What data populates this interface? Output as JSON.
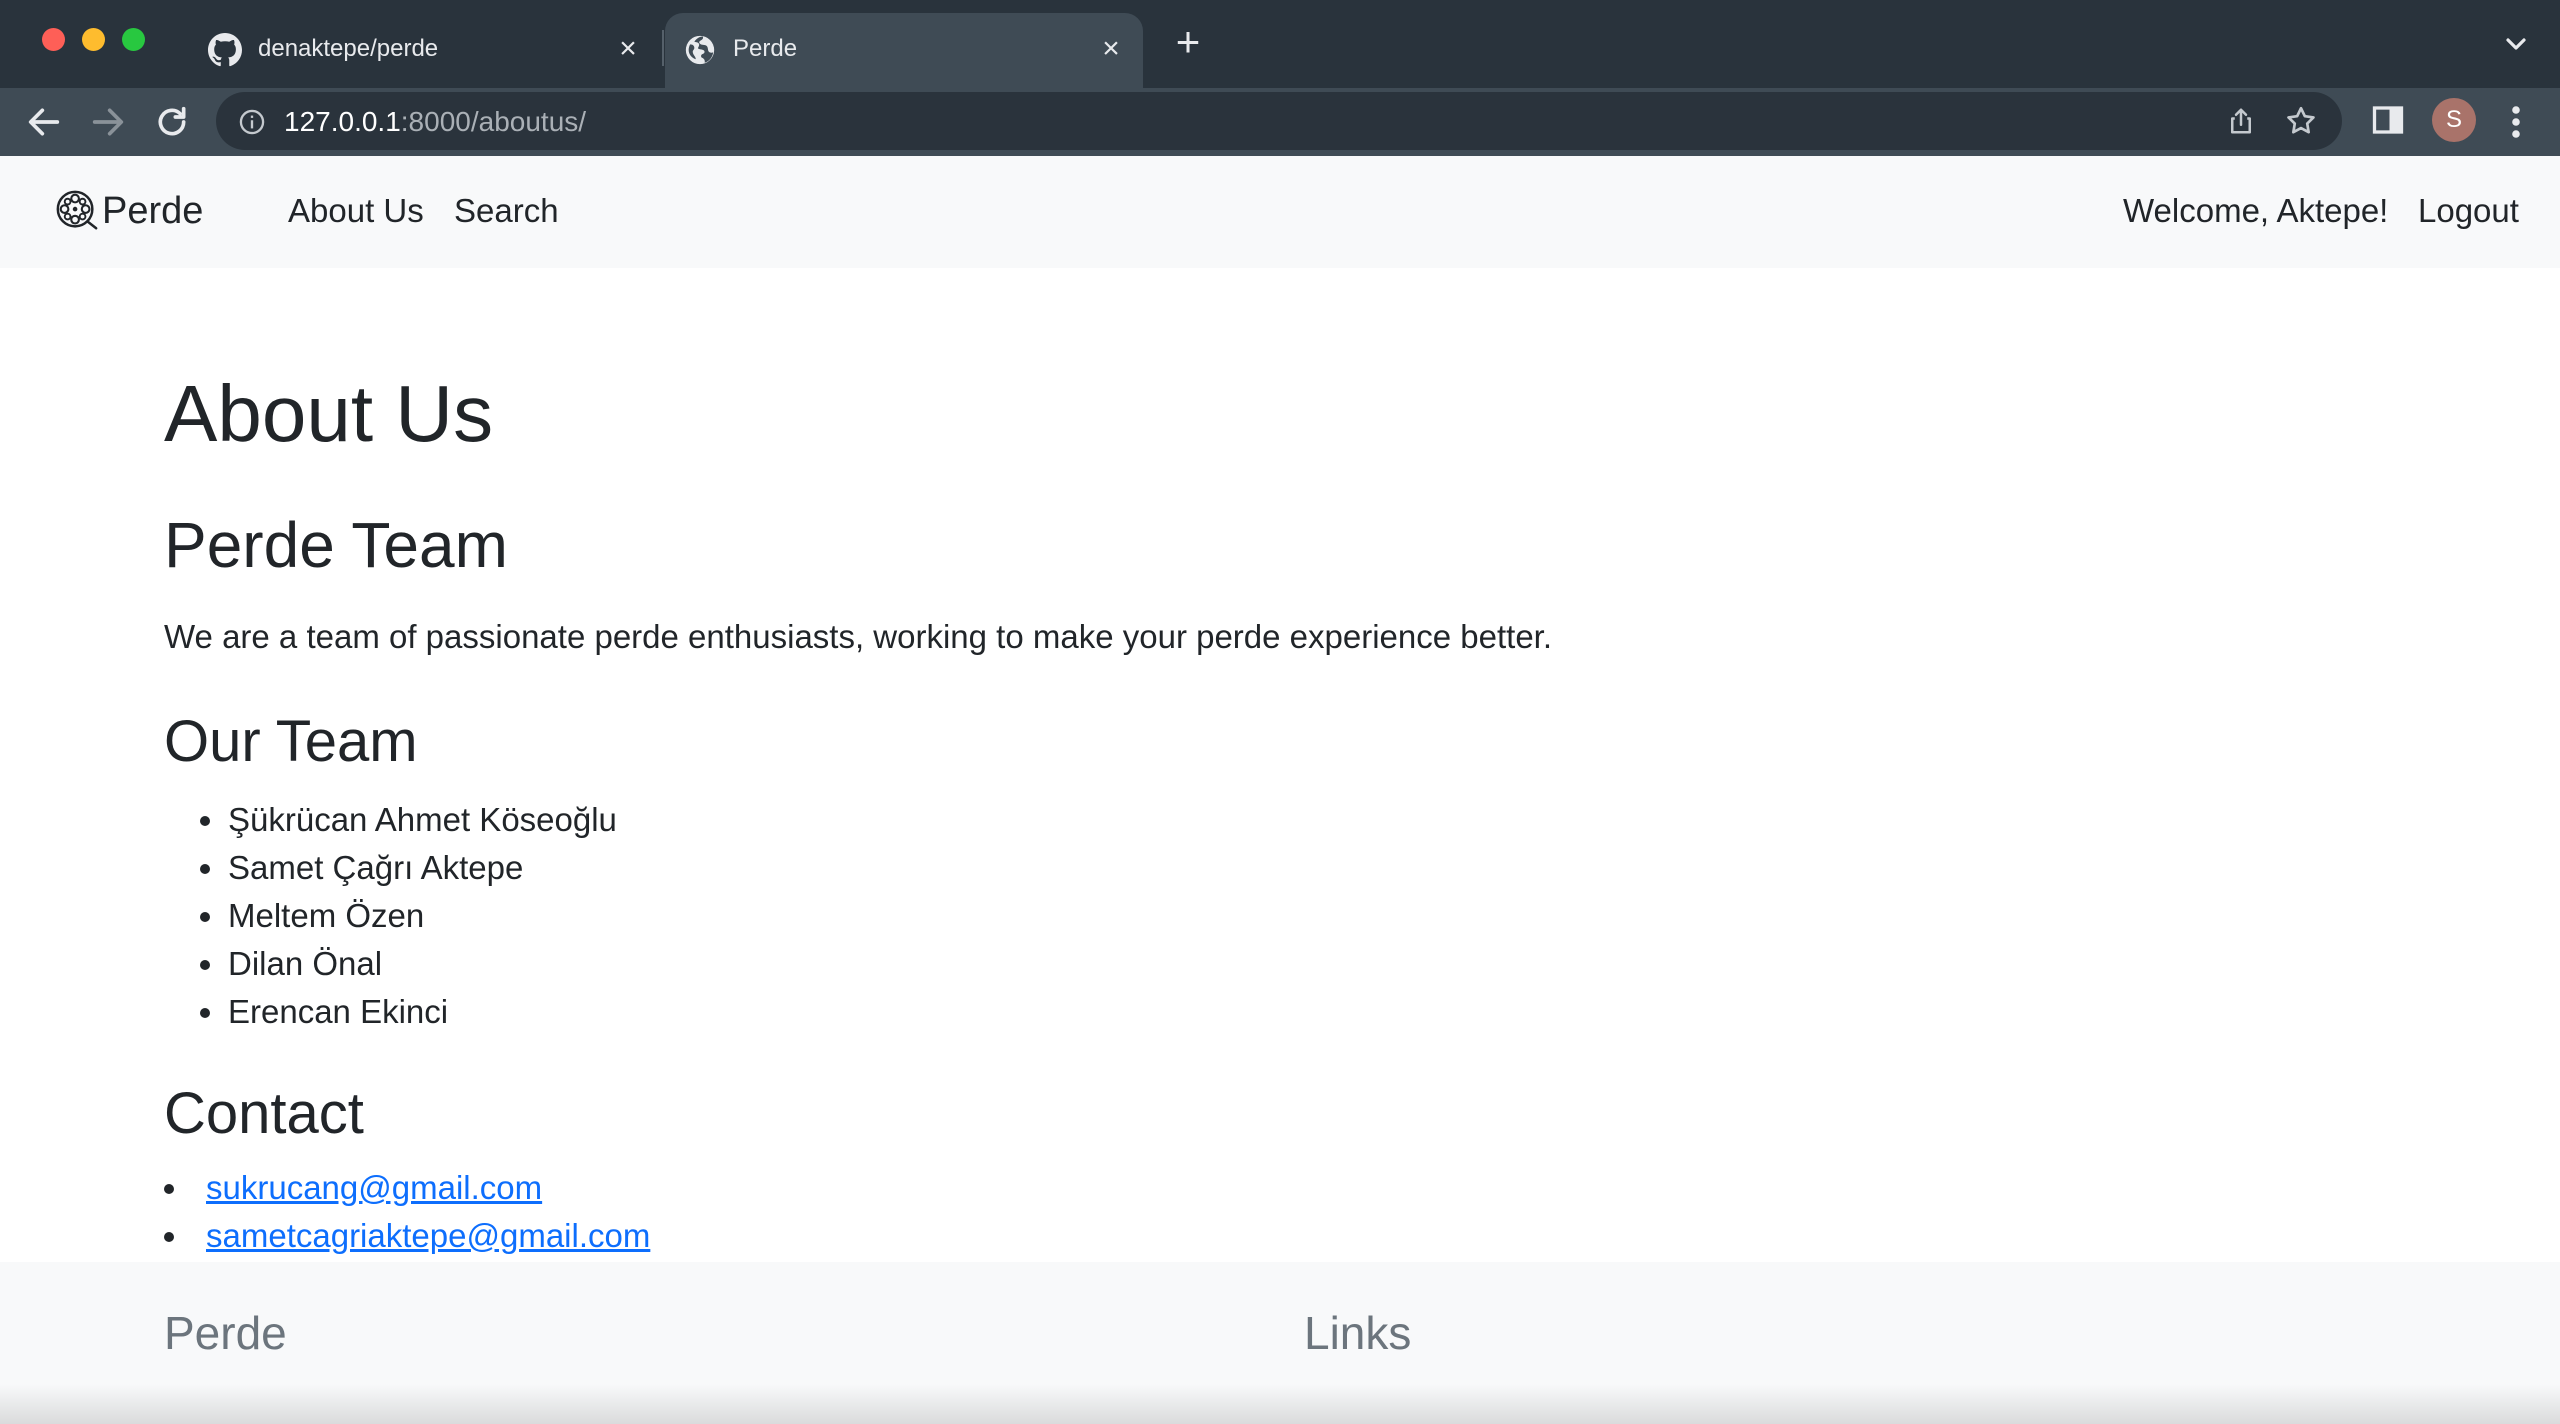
{
  "browser": {
    "tabs": [
      {
        "title": "denaktepe/perde",
        "icon": "github-icon",
        "active": false
      },
      {
        "title": "Perde",
        "icon": "globe-icon",
        "active": true
      }
    ],
    "url_host": "127.0.0.1",
    "url_rest": ":8000/aboutus/",
    "profile_initial": "S"
  },
  "navbar": {
    "brand": "Perde",
    "links": [
      "About Us",
      "Search"
    ],
    "welcome": "Welcome, Aktepe!",
    "logout": "Logout"
  },
  "main": {
    "title": "About Us",
    "team_heading": "Perde Team",
    "team_description": "We are a team of passionate perde enthusiasts, working to make your perde experience better.",
    "our_team_heading": "Our Team",
    "members": [
      "Şükrücan Ahmet Köseoğlu",
      "Samet Çağrı Aktepe",
      "Meltem Özen",
      "Dilan Önal",
      "Erencan Ekinci"
    ],
    "contact_heading": "Contact",
    "contacts": [
      "sukrucang@gmail.com",
      "sametcagriaktepe@gmail.com"
    ]
  },
  "footer": {
    "brand_heading": "Perde",
    "links_heading": "Links"
  },
  "colors": {
    "link": "#0d6efd",
    "navbar_bg": "#f8f9fa",
    "chrome_bg": "#29333c",
    "active_tab": "#3f4b55"
  }
}
